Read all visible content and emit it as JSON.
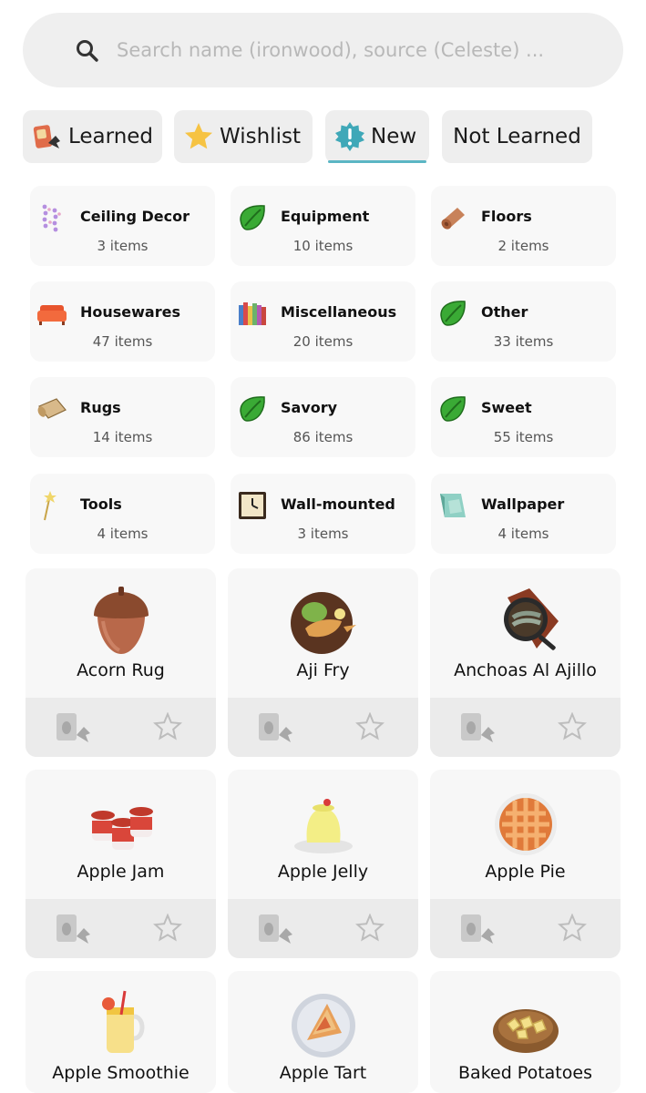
{
  "search": {
    "placeholder": "Search name (ironwood), source (Celeste) ..."
  },
  "filters": [
    {
      "label": "Learned",
      "icon": "recipe-card-icon"
    },
    {
      "label": "Wishlist",
      "icon": "star-icon"
    },
    {
      "label": "New",
      "icon": "new-badge-icon",
      "active": true
    },
    {
      "label": "Not Learned",
      "icon": ""
    }
  ],
  "categories": [
    {
      "name": "Ceiling Decor",
      "count": "3 items",
      "icon": "ceiling-decor-icon"
    },
    {
      "name": "Equipment",
      "count": "10 items",
      "icon": "leaf-icon"
    },
    {
      "name": "Floors",
      "count": "2 items",
      "icon": "floor-roll-icon"
    },
    {
      "name": "Housewares",
      "count": "47 items",
      "icon": "sofa-icon"
    },
    {
      "name": "Miscellaneous",
      "count": "20 items",
      "icon": "books-icon"
    },
    {
      "name": "Other",
      "count": "33 items",
      "icon": "leaf-icon"
    },
    {
      "name": "Rugs",
      "count": "14 items",
      "icon": "rug-icon"
    },
    {
      "name": "Savory",
      "count": "86 items",
      "icon": "leaf-icon"
    },
    {
      "name": "Sweet",
      "count": "55 items",
      "icon": "leaf-icon"
    },
    {
      "name": "Tools",
      "count": "4 items",
      "icon": "wand-icon"
    },
    {
      "name": "Wall-mounted",
      "count": "3 items",
      "icon": "clock-icon"
    },
    {
      "name": "Wallpaper",
      "count": "4 items",
      "icon": "wallpaper-icon"
    }
  ],
  "items": [
    {
      "name": "Acorn Rug",
      "icon": "acorn-icon"
    },
    {
      "name": "Aji Fry",
      "icon": "aji-fry-icon"
    },
    {
      "name": "Anchoas Al Ajillo",
      "icon": "anchoas-icon"
    },
    {
      "name": "Apple Jam",
      "icon": "apple-jam-icon"
    },
    {
      "name": "Apple Jelly",
      "icon": "apple-jelly-icon"
    },
    {
      "name": "Apple Pie",
      "icon": "apple-pie-icon"
    },
    {
      "name": "Apple Smoothie",
      "icon": "apple-smoothie-icon"
    },
    {
      "name": "Apple Tart",
      "icon": "apple-tart-icon"
    },
    {
      "name": "Baked Potatoes",
      "icon": "baked-potatoes-icon"
    }
  ],
  "colors": {
    "accent": "#5bb6c4",
    "leaf": "#3aaa35",
    "card": "#f7f7f7",
    "bar": "#ebebeb"
  }
}
